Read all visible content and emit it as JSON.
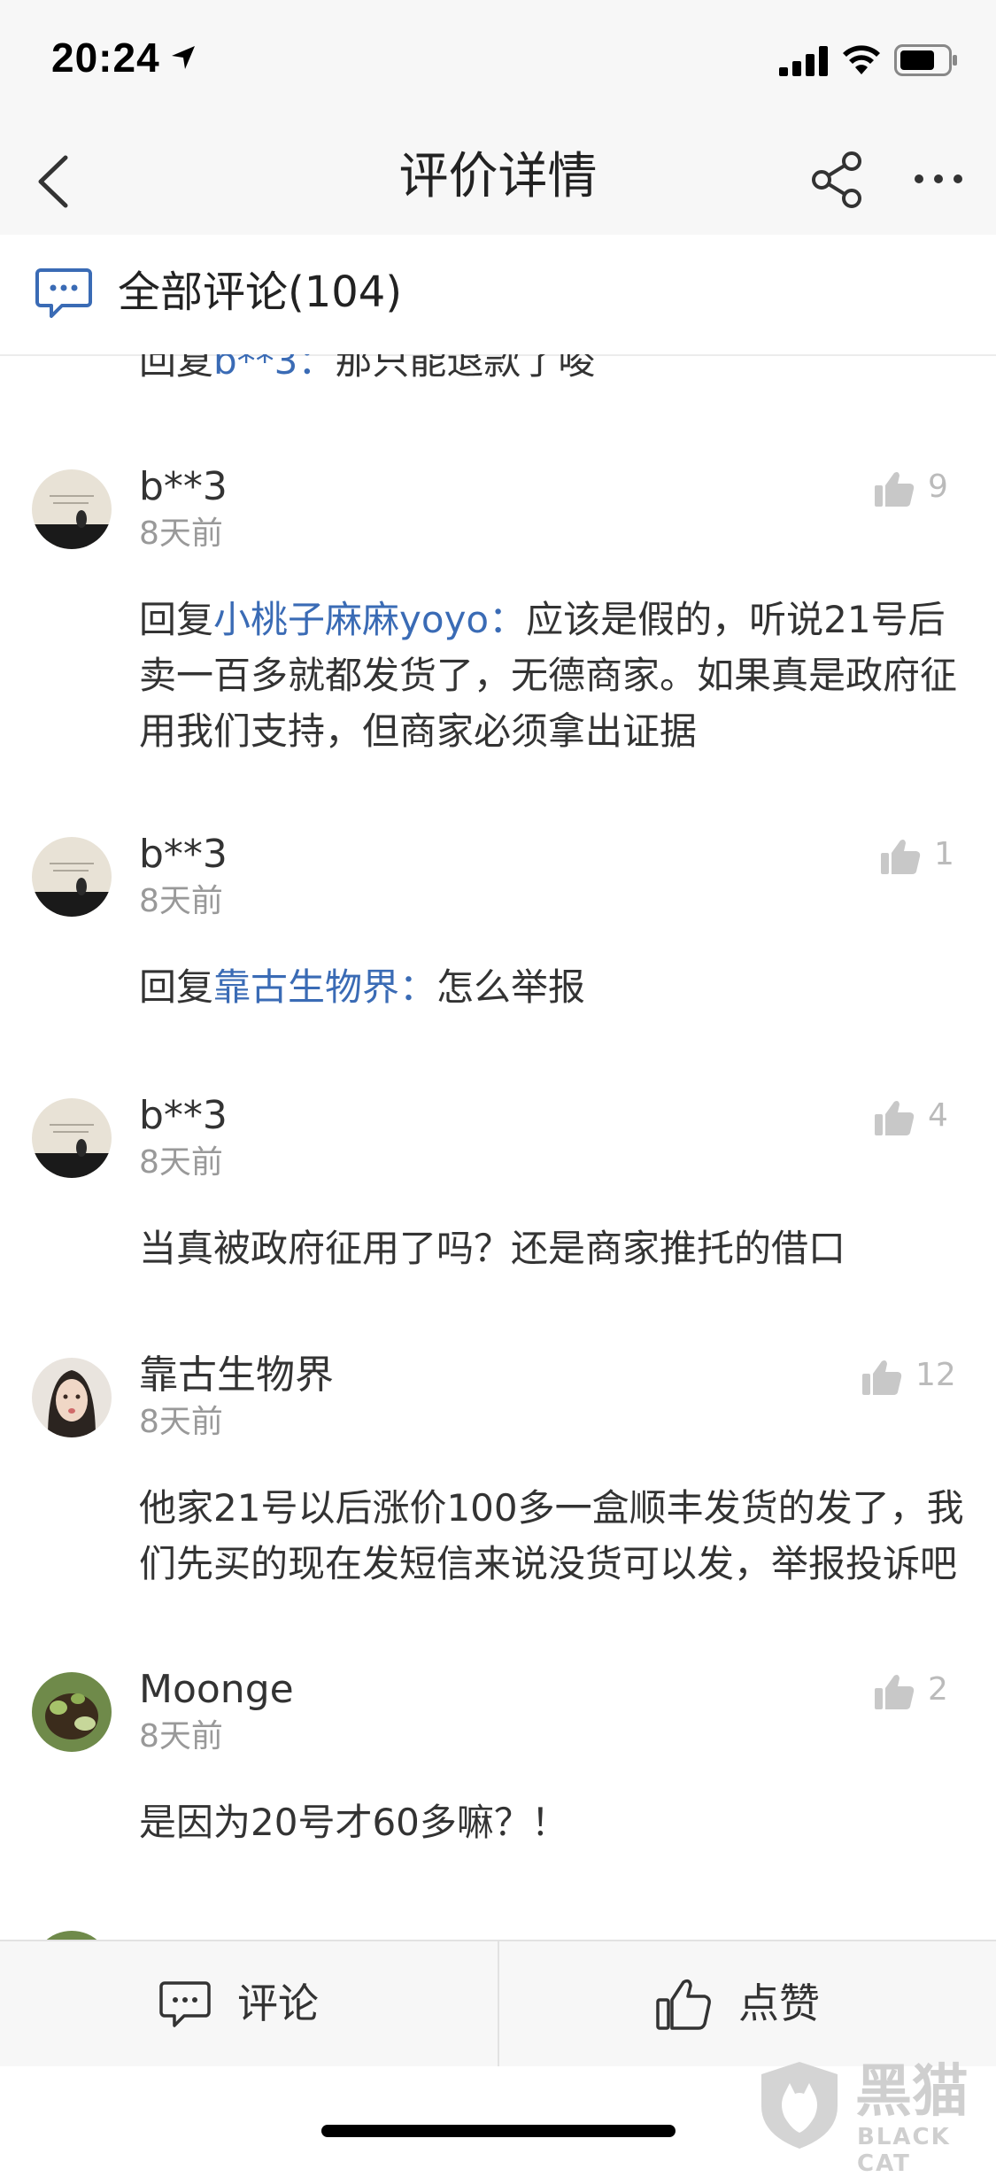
{
  "status_bar": {
    "time": "20:24"
  },
  "nav": {
    "title": "评价详情"
  },
  "section": {
    "title": "全部评论(104)"
  },
  "partial_top": {
    "prefix": "回复",
    "reply_to": "b**3：",
    "text": "那只能退款了唆"
  },
  "comments": [
    {
      "user": "b**3",
      "time": "8天前",
      "likes": "9",
      "reply_prefix": "回复",
      "reply_to": "小桃子麻麻yoyo：",
      "text": "应该是假的，听说21号后卖一百多就都发货了，无德商家。如果真是政府征用我们支持，但商家必须拿出证据"
    },
    {
      "user": "b**3",
      "time": "8天前",
      "likes": "1",
      "reply_prefix": "回复",
      "reply_to": "靠古生物界：",
      "text": "怎么举报"
    },
    {
      "user": "b**3",
      "time": "8天前",
      "likes": "4",
      "text": "当真被政府征用了吗？还是商家推托的借口"
    },
    {
      "user": "靠古生物界",
      "time": "8天前",
      "likes": "12",
      "text": "他家21号以后涨价100多一盒顺丰发货的发了，我们先买的现在发短信来说没货可以发，举报投诉吧"
    },
    {
      "user": "Moonge",
      "time": "8天前",
      "likes": "2",
      "text": "是因为20号才60多嘛？！"
    }
  ],
  "bottom_bar": {
    "comment_label": "评论",
    "like_label": "点赞"
  },
  "watermark": {
    "cn": "黑猫",
    "en": "BLACK CAT"
  },
  "colors": {
    "link": "#3a6bb5",
    "bar_bg": "#f7f7f7",
    "muted": "#999999"
  }
}
